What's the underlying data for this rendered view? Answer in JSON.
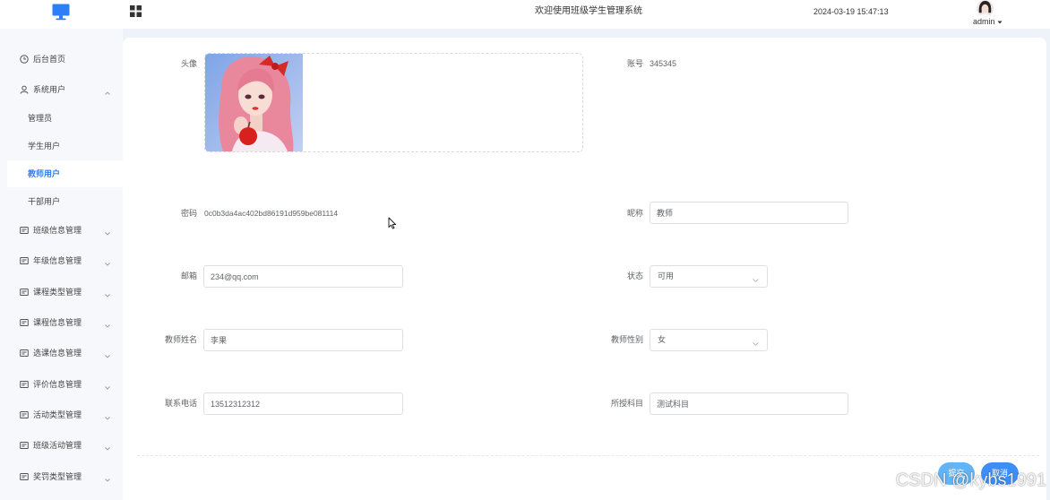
{
  "colors": {
    "brand": "#2d7ff9",
    "submit": "#63b4f6",
    "cancel": "#3e8ef7",
    "page_bg": "#eef2f9"
  },
  "header": {
    "logo_icon": "monitor-icon",
    "menu_icon": "grid-icon",
    "title": "欢迎使用班级学生管理系统",
    "datetime": "2024-03-19 15:47:13",
    "user": "admin"
  },
  "sidebar": {
    "items": [
      {
        "label": "后台首页",
        "icon": "clock-icon"
      },
      {
        "label": "系统用户",
        "icon": "user-icon",
        "expanded": true
      },
      {
        "label": "管理员",
        "sub": true
      },
      {
        "label": "学生用户",
        "sub": true
      },
      {
        "label": "教师用户",
        "sub": true,
        "active": true
      },
      {
        "label": "干部用户",
        "sub": true
      },
      {
        "label": "班级信息管理",
        "icon": "list-icon"
      },
      {
        "label": "年级信息管理",
        "icon": "list-icon"
      },
      {
        "label": "课程类型管理",
        "icon": "list-icon"
      },
      {
        "label": "课程信息管理",
        "icon": "list-icon"
      },
      {
        "label": "选课信息管理",
        "icon": "list-icon"
      },
      {
        "label": "评价信息管理",
        "icon": "list-icon"
      },
      {
        "label": "活动类型管理",
        "icon": "list-icon"
      },
      {
        "label": "班级活动管理",
        "icon": "list-icon"
      },
      {
        "label": "奖罚类型管理",
        "icon": "list-icon"
      }
    ]
  },
  "form": {
    "avatar": {
      "label": "头像"
    },
    "account": {
      "label": "账号",
      "value": "345345"
    },
    "password": {
      "label": "密码",
      "value": "0c0b3da4ac402bd86191d959be081114"
    },
    "nickname": {
      "label": "昵称",
      "value": "教师"
    },
    "email": {
      "label": "邮箱",
      "value": "234@qq.com"
    },
    "status": {
      "label": "状态",
      "value": "可用"
    },
    "name": {
      "label": "教师姓名",
      "value": "李果"
    },
    "gender": {
      "label": "教师性别",
      "value": "女"
    },
    "phone": {
      "label": "联系电话",
      "value": "13512312312"
    },
    "subject": {
      "label": "所授科目",
      "value": "测试科目"
    }
  },
  "actions": {
    "submit": "提交",
    "cancel": "取消"
  },
  "watermark": "CSDN @kybs1991"
}
